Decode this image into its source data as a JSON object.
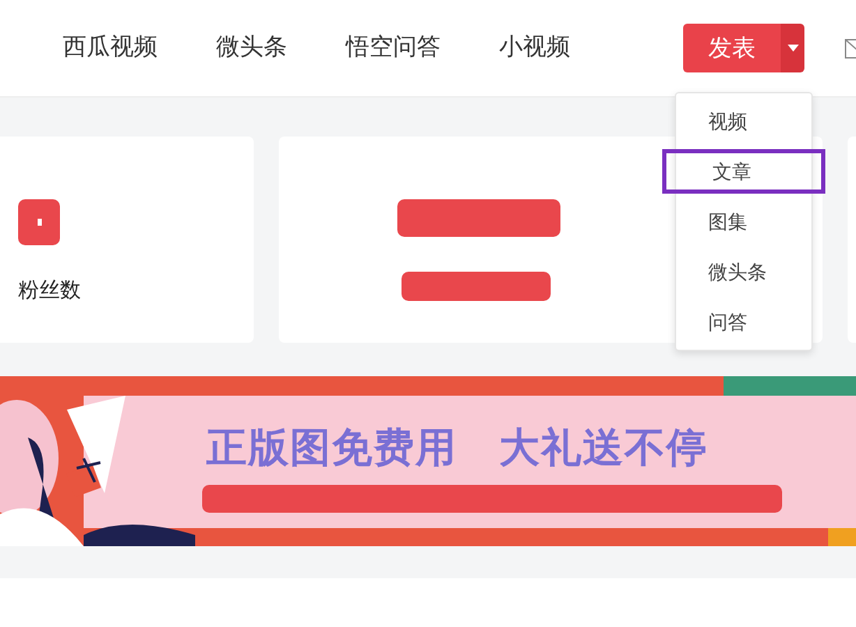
{
  "nav": {
    "tabs": [
      {
        "label": "西瓜视频"
      },
      {
        "label": "微头条"
      },
      {
        "label": "悟空问答"
      },
      {
        "label": "小视频"
      }
    ],
    "publish_button": "发表"
  },
  "publish_menu": [
    {
      "label": "视频",
      "highlighted": false
    },
    {
      "label": "文章",
      "highlighted": true
    },
    {
      "label": "图集",
      "highlighted": false
    },
    {
      "label": "微头条",
      "highlighted": false
    },
    {
      "label": "问答",
      "highlighted": false
    }
  ],
  "stats": [
    {
      "label": "粉丝数"
    }
  ],
  "banner": {
    "headline": "正版图免费用",
    "headline_2": "大礼送不停"
  }
}
